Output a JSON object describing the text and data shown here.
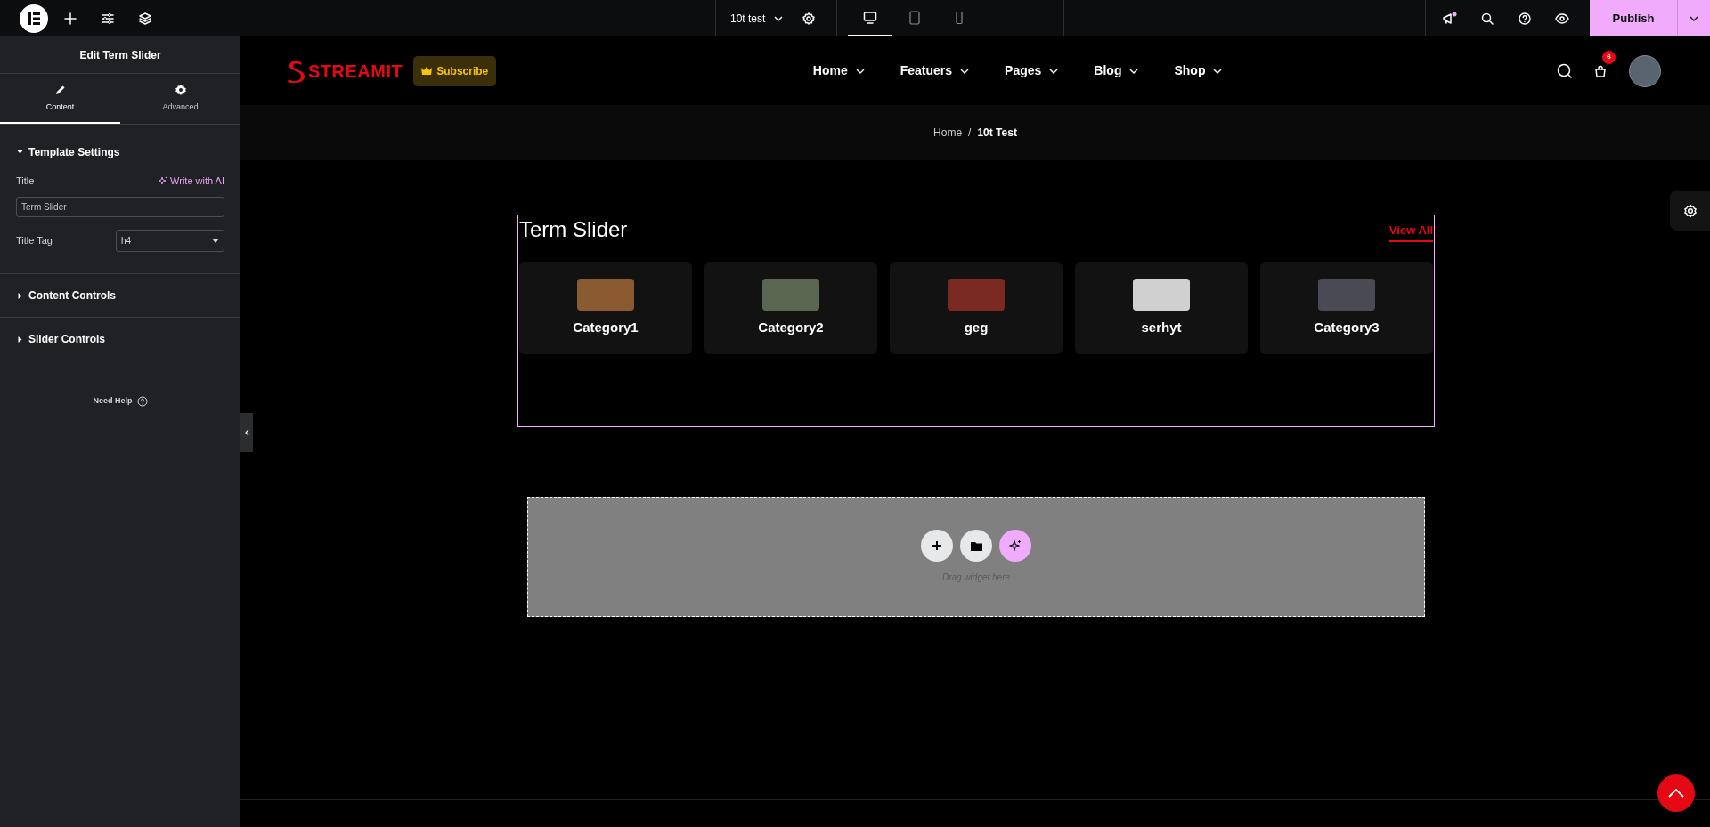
{
  "topbar": {
    "document_title": "10t test",
    "devices": [
      {
        "kind": "desktop",
        "selected": true
      },
      {
        "kind": "tablet",
        "selected": false
      },
      {
        "kind": "mobile",
        "selected": false
      }
    ],
    "publish_label": "Publish"
  },
  "panel": {
    "title": "Edit Term Slider",
    "tabs": [
      {
        "kind": "content",
        "label": "Content",
        "selected": true
      },
      {
        "kind": "advanced",
        "label": "Advanced",
        "selected": false
      }
    ],
    "sections": [
      {
        "label": "Template Settings",
        "expanded": true,
        "fields": [
          {
            "kind": "text",
            "label": "Title",
            "ai_link": "Write with AI",
            "value": "Term Slider"
          },
          {
            "kind": "select",
            "label": "Title Tag",
            "value": "h4"
          }
        ]
      },
      {
        "label": "Content Controls",
        "expanded": false
      },
      {
        "label": "Slider Controls",
        "expanded": false
      }
    ],
    "help": "Need Help"
  },
  "site": {
    "logo": "STREAMIT",
    "subscribe": "Subscribe",
    "nav": [
      {
        "label": "Home"
      },
      {
        "label": "Featuers"
      },
      {
        "label": "Pages"
      },
      {
        "label": "Blog"
      },
      {
        "label": "Shop"
      }
    ],
    "cart_count": "6",
    "breadcrumb": [
      {
        "label": "Home",
        "selected": false
      },
      {
        "label": "10t Test",
        "selected": true
      }
    ],
    "breadcrumb_separator": "/",
    "term_slider": {
      "title": "Term Slider",
      "view_all": "View All",
      "cards": [
        {
          "label": "Category1"
        },
        {
          "label": "Category2"
        },
        {
          "label": "geg"
        },
        {
          "label": "serhyt"
        },
        {
          "label": "Category3"
        }
      ]
    },
    "drop_hint": "Drag widget here"
  }
}
